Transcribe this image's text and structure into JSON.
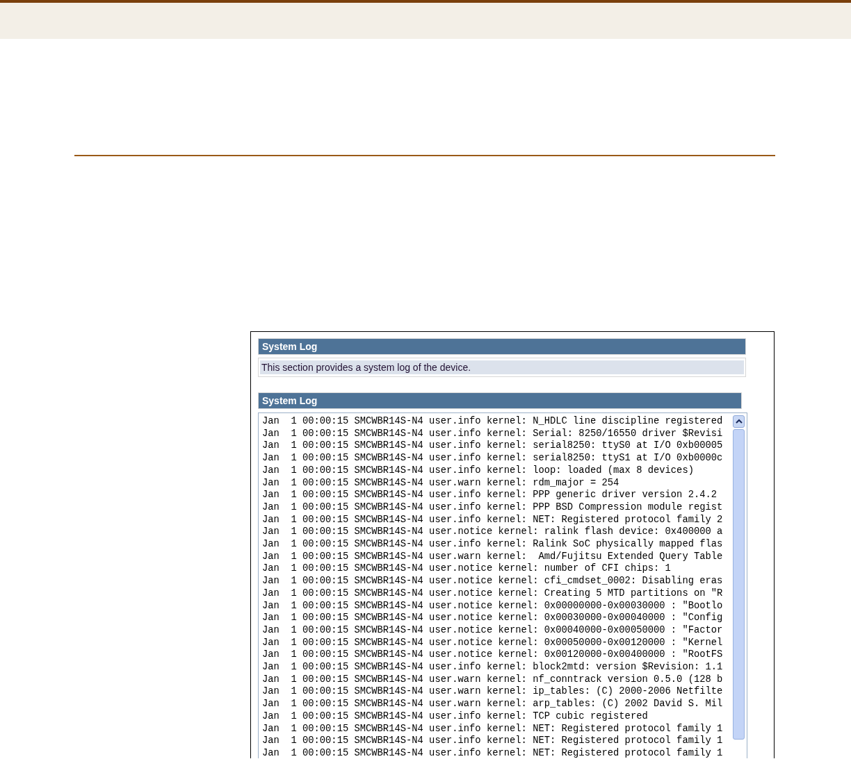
{
  "panels": [
    {
      "title": "System Log",
      "description": "This section provides a system log of the device."
    },
    {
      "title": "System Log",
      "log_lines": [
        "Jan  1 00:00:15 SMCWBR14S-N4 user.info kernel: N_HDLC line discipline registered",
        "Jan  1 00:00:15 SMCWBR14S-N4 user.info kernel: Serial: 8250/16550 driver $Revisi",
        "Jan  1 00:00:15 SMCWBR14S-N4 user.info kernel: serial8250: ttyS0 at I/O 0xb00005",
        "Jan  1 00:00:15 SMCWBR14S-N4 user.info kernel: serial8250: ttyS1 at I/O 0xb0000c",
        "Jan  1 00:00:15 SMCWBR14S-N4 user.info kernel: loop: loaded (max 8 devices)",
        "Jan  1 00:00:15 SMCWBR14S-N4 user.warn kernel: rdm_major = 254",
        "Jan  1 00:00:15 SMCWBR14S-N4 user.info kernel: PPP generic driver version 2.4.2",
        "Jan  1 00:00:15 SMCWBR14S-N4 user.info kernel: PPP BSD Compression module regist",
        "Jan  1 00:00:15 SMCWBR14S-N4 user.info kernel: NET: Registered protocol family 2",
        "Jan  1 00:00:15 SMCWBR14S-N4 user.notice kernel: ralink flash device: 0x400000 a",
        "Jan  1 00:00:15 SMCWBR14S-N4 user.info kernel: Ralink SoC physically mapped flas",
        "Jan  1 00:00:15 SMCWBR14S-N4 user.warn kernel:  Amd/Fujitsu Extended Query Table",
        "Jan  1 00:00:15 SMCWBR14S-N4 user.notice kernel: number of CFI chips: 1",
        "Jan  1 00:00:15 SMCWBR14S-N4 user.notice kernel: cfi_cmdset_0002: Disabling eras",
        "Jan  1 00:00:15 SMCWBR14S-N4 user.notice kernel: Creating 5 MTD partitions on \"R",
        "Jan  1 00:00:15 SMCWBR14S-N4 user.notice kernel: 0x00000000-0x00030000 : \"Bootlo",
        "Jan  1 00:00:15 SMCWBR14S-N4 user.notice kernel: 0x00030000-0x00040000 : \"Config",
        "Jan  1 00:00:15 SMCWBR14S-N4 user.notice kernel: 0x00040000-0x00050000 : \"Factor",
        "Jan  1 00:00:15 SMCWBR14S-N4 user.notice kernel: 0x00050000-0x00120000 : \"Kernel",
        "Jan  1 00:00:15 SMCWBR14S-N4 user.notice kernel: 0x00120000-0x00400000 : \"RootFS",
        "Jan  1 00:00:15 SMCWBR14S-N4 user.info kernel: block2mtd: version $Revision: 1.1",
        "Jan  1 00:00:15 SMCWBR14S-N4 user.warn kernel: nf_conntrack version 0.5.0 (128 b",
        "Jan  1 00:00:15 SMCWBR14S-N4 user.warn kernel: ip_tables: (C) 2000-2006 Netfilte",
        "Jan  1 00:00:15 SMCWBR14S-N4 user.warn kernel: arp_tables: (C) 2002 David S. Mil",
        "Jan  1 00:00:15 SMCWBR14S-N4 user.info kernel: TCP cubic registered",
        "Jan  1 00:00:15 SMCWBR14S-N4 user.info kernel: NET: Registered protocol family 1",
        "Jan  1 00:00:15 SMCWBR14S-N4 user.info kernel: NET: Registered protocol family 1",
        "Jan  1 00:00:15 SMCWBR14S-N4 user.info kernel: NET: Registered protocol family 1"
      ]
    }
  ]
}
